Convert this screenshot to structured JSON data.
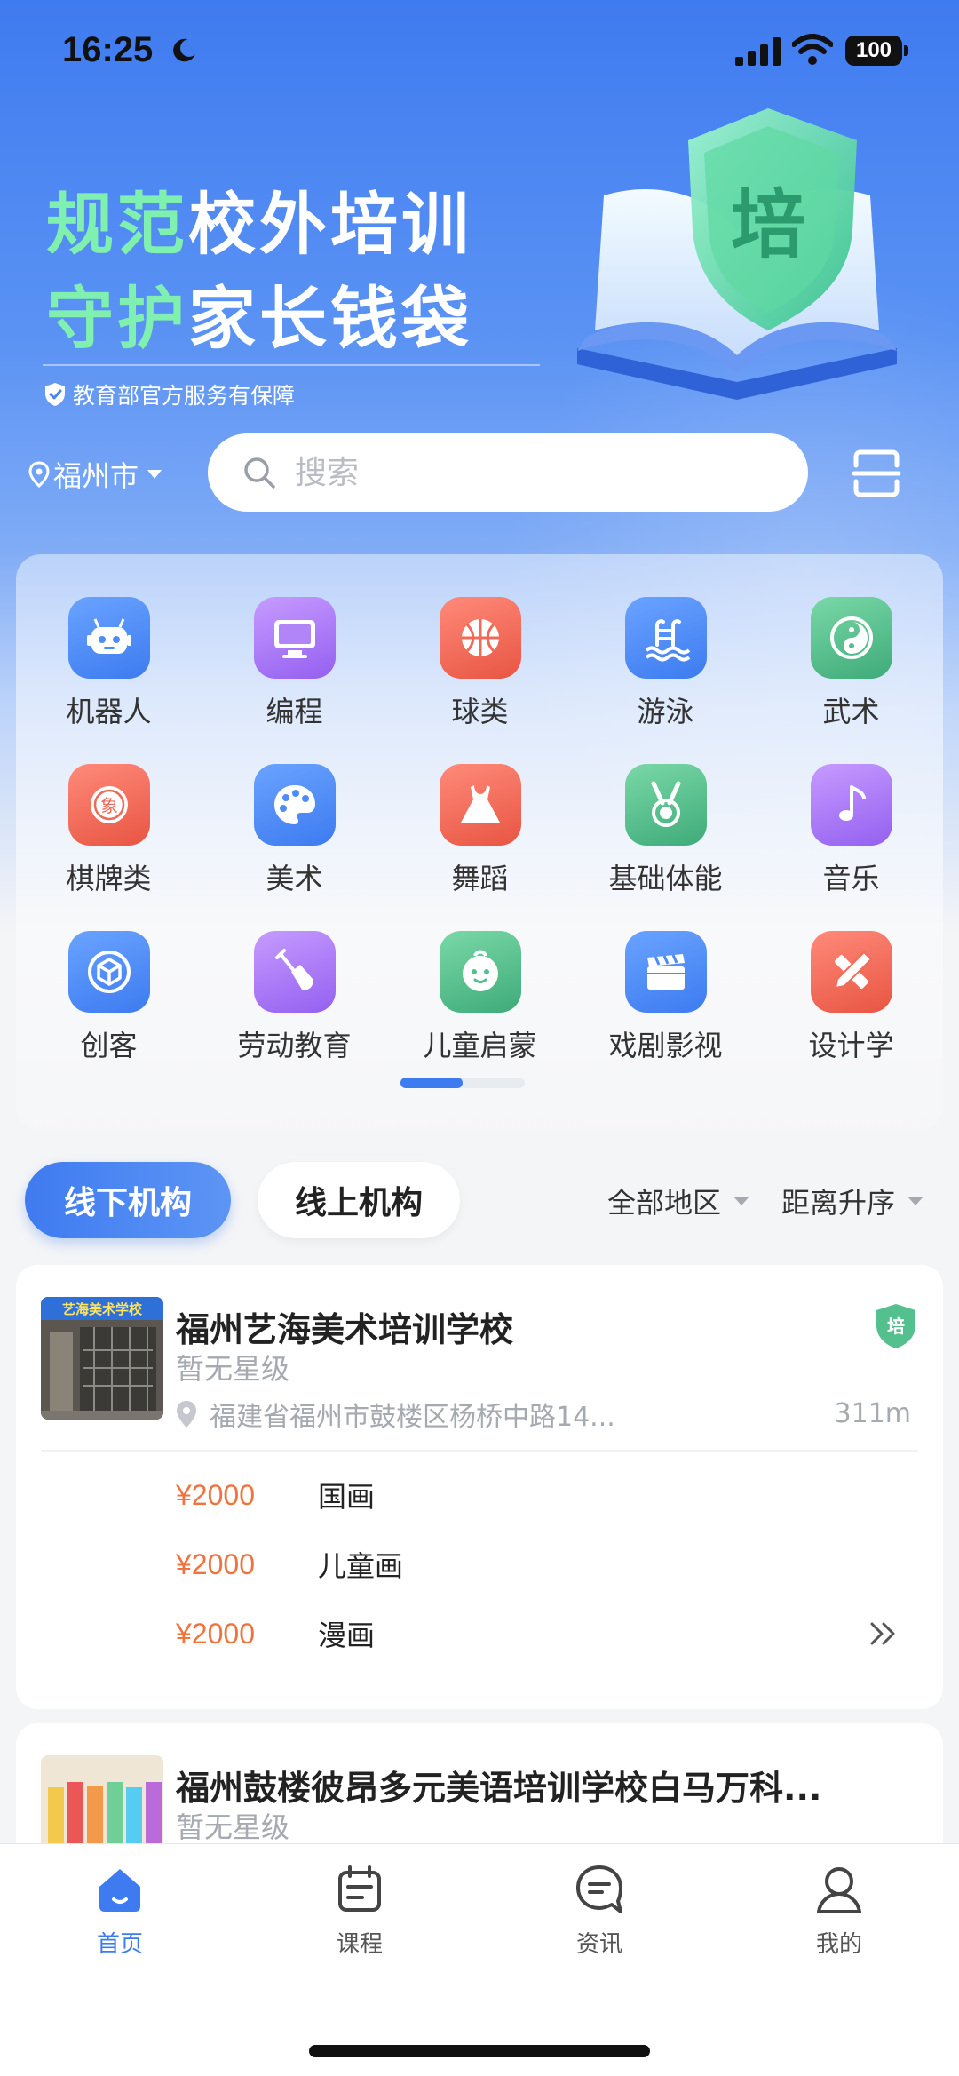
{
  "status_bar": {
    "time": "16:25",
    "battery": "100"
  },
  "banner": {
    "line1_highlight": "规范",
    "line1_rest": "校外培训",
    "line2_highlight": "守护",
    "line2_rest": "家长钱袋",
    "guarantee": "教育部官方服务有保障",
    "badge_char": "培"
  },
  "location": {
    "city": "福州市"
  },
  "search": {
    "placeholder": "搜索"
  },
  "categories": [
    {
      "label": "机器人",
      "icon": "robot-icon",
      "color": "#4d8cf6"
    },
    {
      "label": "编程",
      "icon": "computer-icon",
      "color": "#a977f5"
    },
    {
      "label": "球类",
      "icon": "basketball-icon",
      "color": "#ef6a57"
    },
    {
      "label": "游泳",
      "icon": "swimming-pool-icon",
      "color": "#4d8cf6"
    },
    {
      "label": "武术",
      "icon": "yin-yang-icon",
      "color": "#54c08d"
    },
    {
      "label": "棋牌类",
      "icon": "chess-piece-icon",
      "color": "#ef6a57"
    },
    {
      "label": "美术",
      "icon": "palette-icon",
      "color": "#4d8cf6"
    },
    {
      "label": "舞蹈",
      "icon": "dress-icon",
      "color": "#ef6a57"
    },
    {
      "label": "基础体能",
      "icon": "medal-icon",
      "color": "#54c08d"
    },
    {
      "label": "音乐",
      "icon": "music-note-icon",
      "color": "#a977f5"
    },
    {
      "label": "创客",
      "icon": "cube-icon",
      "color": "#4d8cf6"
    },
    {
      "label": "劳动教育",
      "icon": "shovel-icon",
      "color": "#a977f5"
    },
    {
      "label": "儿童启蒙",
      "icon": "baby-face-icon",
      "color": "#54c08d"
    },
    {
      "label": "戏剧影视",
      "icon": "clapperboard-icon",
      "color": "#4d8cf6"
    },
    {
      "label": "设计学",
      "icon": "ruler-pencil-icon",
      "color": "#ef6a57"
    }
  ],
  "category_pager": {
    "current_page": 1,
    "total_pages": 2
  },
  "filters": {
    "tab_offline": "线下机构",
    "tab_online": "线上机构",
    "active_tab": "线下机构",
    "region": "全部地区",
    "sort": "距离升序"
  },
  "schools": [
    {
      "name": "福州艺海美术培训学校",
      "rating": "暂无星级",
      "address": "福建省福州市鼓楼区杨桥中路14...",
      "distance": "311m",
      "thumb_text": "艺海美术学校",
      "courses": [
        {
          "price": "¥2000",
          "name": "国画"
        },
        {
          "price": "¥2000",
          "name": "儿童画"
        },
        {
          "price": "¥2000",
          "name": "漫画"
        }
      ]
    },
    {
      "name": "福州鼓楼彼昂多元美语培训学校白马万科...",
      "rating": "暂无星级"
    }
  ],
  "bottom_nav": [
    {
      "label": "首页",
      "icon": "home-icon",
      "active": true
    },
    {
      "label": "课程",
      "icon": "calendar-icon",
      "active": false
    },
    {
      "label": "资讯",
      "icon": "chat-bubble-icon",
      "active": false
    },
    {
      "label": "我的",
      "icon": "user-icon",
      "active": false
    }
  ],
  "colors": {
    "brand_blue": "#3f7bf0",
    "price_orange": "#f0733e",
    "slogan_green": "#7ff0b0",
    "cert_green": "#54c08d"
  }
}
